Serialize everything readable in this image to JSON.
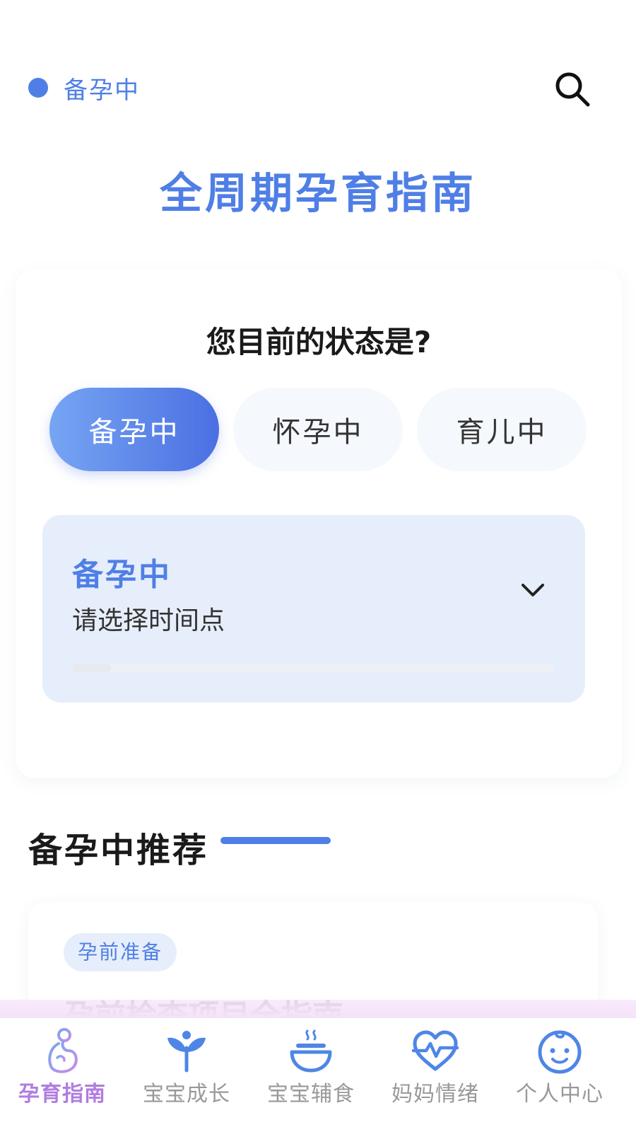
{
  "header": {
    "status_label": "备孕中",
    "title": "全周期孕育指南"
  },
  "status_card": {
    "question": "您目前的状态是?",
    "choices": [
      {
        "label": "备孕中",
        "active": true
      },
      {
        "label": "怀孕中",
        "active": false
      },
      {
        "label": "育儿中",
        "active": false
      }
    ],
    "time_picker": {
      "title": "备孕中",
      "placeholder": "请选择时间点",
      "progress": 0.08
    }
  },
  "recommendations": {
    "title": "备孕中推荐",
    "cards": [
      {
        "tag": "孕前准备",
        "headline": "孕前检查项目全指南"
      }
    ]
  },
  "tabbar": {
    "items": [
      {
        "label": "孕育指南",
        "icon": "pregnancy-icon",
        "active": true
      },
      {
        "label": "宝宝成长",
        "icon": "sprout-icon",
        "active": false
      },
      {
        "label": "宝宝辅食",
        "icon": "bowl-icon",
        "active": false
      },
      {
        "label": "妈妈情绪",
        "icon": "heartbeat-icon",
        "active": false
      },
      {
        "label": "个人中心",
        "icon": "baby-face-icon",
        "active": false
      }
    ]
  },
  "colors": {
    "primary": "#4f7fe6",
    "active_tab": "#b07de0",
    "picker_bg": "#e6eefb"
  }
}
